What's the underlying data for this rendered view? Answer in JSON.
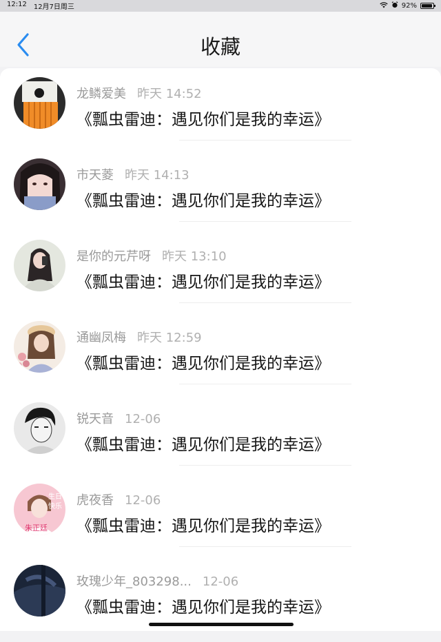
{
  "status_bar": {
    "time": "12:12",
    "date": "12月7日周三",
    "battery": "92%",
    "battery_level": 0.92
  },
  "header": {
    "title": "收藏",
    "back_icon": "chevron-left-icon",
    "accent": "#2a8cf0"
  },
  "items": [
    {
      "user": "龙鳞爱美",
      "time": "昨天 14:52",
      "title": "《瓢虫雷迪：遇见你们是我的幸运》"
    },
    {
      "user": "市天菱",
      "time": "昨天 14:13",
      "title": "《瓢虫雷迪：遇见你们是我的幸运》"
    },
    {
      "user": "是你的元芹呀",
      "time": "昨天 13:10",
      "title": "《瓢虫雷迪：遇见你们是我的幸运》"
    },
    {
      "user": "通幽凤梅",
      "time": "昨天 12:59",
      "title": "《瓢虫雷迪：遇见你们是我的幸运》"
    },
    {
      "user": "锐天音",
      "time": "12-06",
      "title": "《瓢虫雷迪：遇见你们是我的幸运》"
    },
    {
      "user": "虎夜香",
      "time": "12-06",
      "title": "《瓢虫雷迪：遇见你们是我的幸运》",
      "avatar_text": [
        "生日",
        "快乐",
        "朱正廷"
      ]
    },
    {
      "user": "玫瑰少年_803298...",
      "time": "12-06",
      "title": "《瓢虫雷迪：遇见你们是我的幸运》"
    }
  ]
}
